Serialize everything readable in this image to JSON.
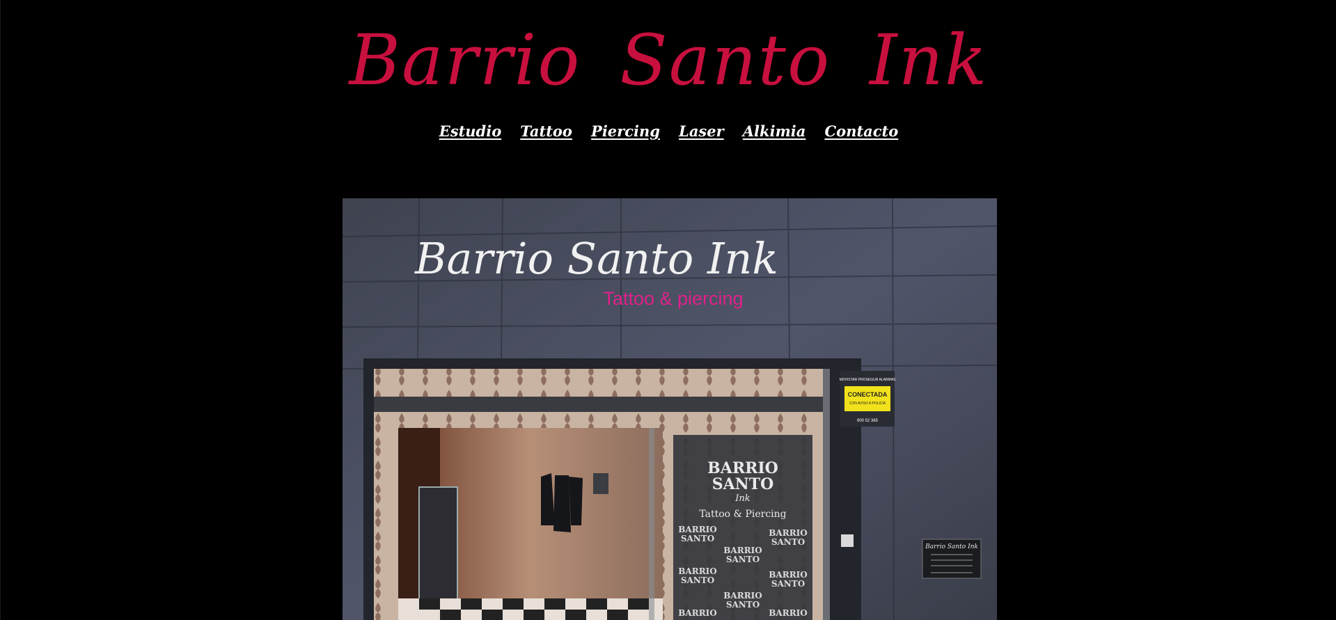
{
  "site": {
    "title": "Barrio Santo Ink",
    "title_color": "#c8103e"
  },
  "nav": {
    "items": [
      "Estudio",
      "Tattoo",
      "Piercing",
      "Laser",
      "Alkimia",
      "Contacto"
    ]
  },
  "hero": {
    "sign_title": "Barrio Santo Ink",
    "sign_subtitle": "Tattoo & piercing",
    "sign_subtitle_color": "#e0218a",
    "door_logo_line1": "BARRIO",
    "door_logo_line2": "SANTO",
    "door_logo_line3": "Ink",
    "door_logo_tagline": "Tattoo & Piercing",
    "alarm_brand": "MOVISTAR PROSEGUR ALARMAS",
    "alarm_status": "CONECTADA",
    "alarm_subtext": "CON AVISO A POLICÍA",
    "alarm_phone": "900 52 365",
    "hours_sign_title": "Barrio Santo Ink"
  }
}
